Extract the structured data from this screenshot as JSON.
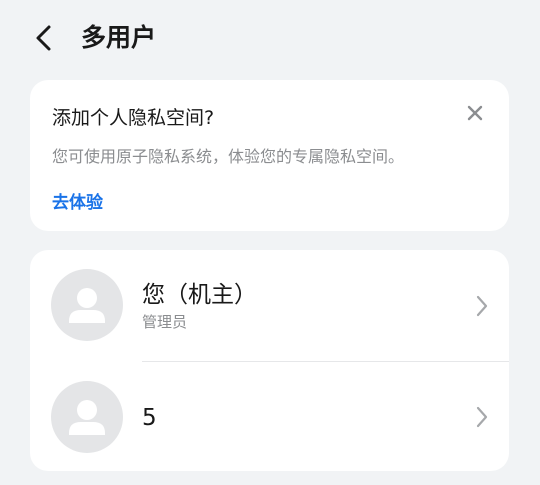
{
  "header": {
    "title": "多用户",
    "back_icon": "chevron-left-icon"
  },
  "privacy_card": {
    "title": "添加个人隐私空间?",
    "description": "您可使用原子隐私系统，体验您的专属隐私空间。",
    "action_label": "去体验",
    "close_icon": "close-icon"
  },
  "users": [
    {
      "name": "您（机主）",
      "role": "管理员",
      "avatar_icon": "person-icon",
      "chevron_icon": "chevron-right-icon"
    },
    {
      "name": "5",
      "role": "",
      "avatar_icon": "person-icon",
      "chevron_icon": "chevron-right-icon"
    }
  ],
  "colors": {
    "background": "#f1f3f5",
    "card": "#ffffff",
    "accent": "#1a73e8",
    "secondary_text": "#8b8d90",
    "avatar_bg": "#e4e5e7",
    "avatar_fg": "#ffffff"
  }
}
